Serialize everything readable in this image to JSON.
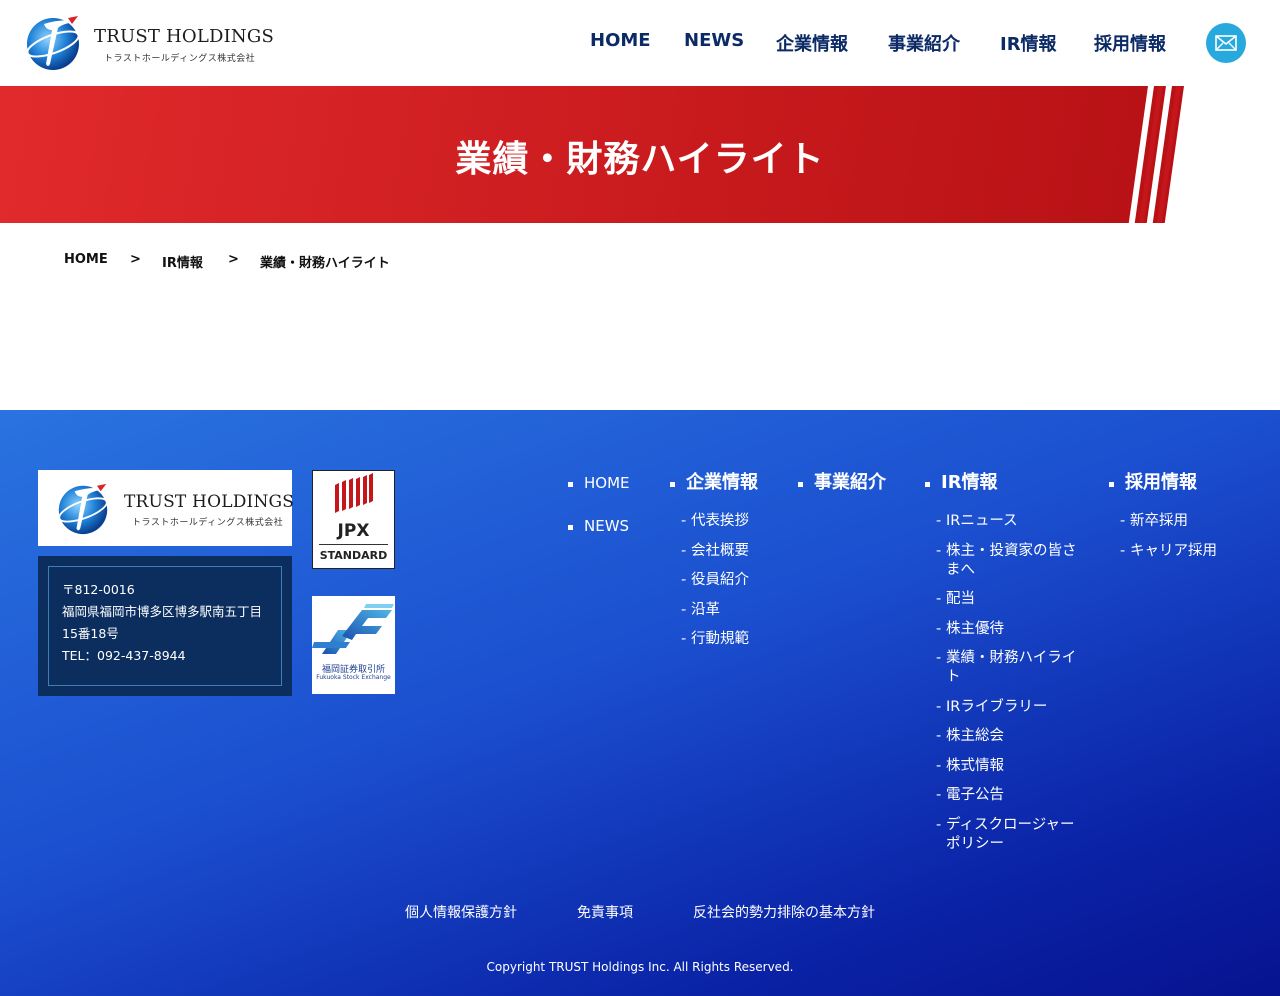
{
  "header": {
    "logo_main": "TRUST HOLDINGS",
    "logo_sub": "トラストホールディングス株式会社",
    "nav": [
      "HOME",
      "NEWS",
      "企業情報",
      "事業紹介",
      "IR情報",
      "採用情報"
    ],
    "mail_icon": "mail-icon"
  },
  "hero": {
    "title": "業績・財務ハイライト"
  },
  "breadcrumb": {
    "items": [
      "HOME",
      "IR情報",
      "業績・財務ハイライト"
    ],
    "separator": ">"
  },
  "footer": {
    "logo_main": "TRUST HOLDINGS",
    "logo_sub": "トラストホールディングス株式会社",
    "address": {
      "postal": "〒812-0016",
      "line1": "福岡県福岡市博多区博多駅南五丁目",
      "line2": "15番18号",
      "tel": "TEL：092-437-8944"
    },
    "jpx": {
      "label": "JPX",
      "market": "STANDARD"
    },
    "fse": {
      "label_jp": "福岡証券取引所",
      "label_en": "Fukuoka Stock Exchange"
    },
    "nav": {
      "home": "HOME",
      "news": "NEWS",
      "company": {
        "title": "企業情報",
        "items": [
          "代表挨拶",
          "会社概要",
          "役員紹介",
          "沿革",
          "行動規範"
        ]
      },
      "business": {
        "title": "事業紹介"
      },
      "ir": {
        "title": "IR情報",
        "items": [
          "IRニュース",
          "株主・投資家の皆さまへ",
          "配当",
          "株主優待",
          "業績・財務ハイライト",
          "IRライブラリー",
          "株主総会",
          "株式情報",
          "電子公告",
          "ディスクロージャーポリシー"
        ]
      },
      "recruit": {
        "title": "採用情報",
        "items": [
          "新卒採用",
          "キャリア採用"
        ]
      }
    },
    "links": [
      "個人情報保護方針",
      "免責事項",
      "反社会的勢力排除の基本方針"
    ],
    "copyright": "Copyright TRUST Holdings Inc. All Rights Reserved."
  },
  "colors": {
    "nav_text": "#0b2a66",
    "hero_red": "#d21e22",
    "mail_button": "#27a9de",
    "footer_blue": "#1b4fcf",
    "address_bg": "#0b2e5e"
  }
}
